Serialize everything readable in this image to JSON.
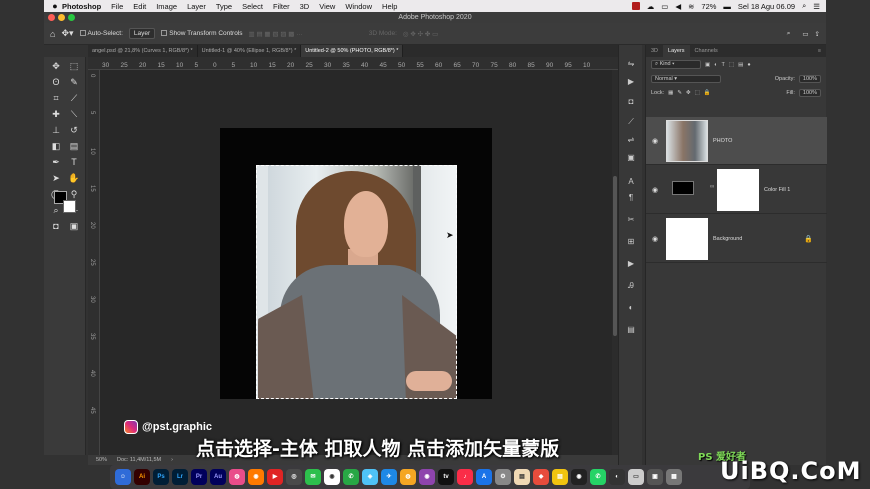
{
  "menubar": {
    "apple": "",
    "items": [
      "Photoshop",
      "File",
      "Edit",
      "Image",
      "Layer",
      "Type",
      "Select",
      "Filter",
      "3D",
      "View",
      "Window",
      "Help"
    ],
    "battery": "72%",
    "datetime": "Sel 18 Agu 06.09"
  },
  "window": {
    "title": "Adobe Photoshop 2020"
  },
  "options": {
    "auto_select": "Auto-Select:",
    "target": "Layer",
    "show_transform": "Show Transform Controls",
    "mode_3d": "3D Mode:"
  },
  "tabs": [
    "angel.psd @ 21,8% (Curves 1, RGB/8*) *",
    "Untitled-1 @ 40% (Ellipse 1, RGB/8*) *",
    "Untitled-2 @ 50% (PHOTO, RGB/8*) *"
  ],
  "ruler": {
    "h": [
      "30",
      "25",
      "20",
      "15",
      "10",
      "5",
      "0",
      "5",
      "10",
      "15",
      "20",
      "25",
      "30",
      "35",
      "40",
      "45",
      "50",
      "55",
      "60",
      "65",
      "70",
      "75",
      "80",
      "85",
      "90",
      "95",
      "10"
    ],
    "v": [
      "0",
      "5",
      "10",
      "15",
      "20",
      "25",
      "30",
      "35",
      "40",
      "45"
    ]
  },
  "status": {
    "zoom": "50%",
    "doc": "Doc: 11,4M/11,5M"
  },
  "panel": {
    "tabs": [
      "3D",
      "Layers",
      "Channels"
    ],
    "kind": "Kind",
    "blend": "Normal",
    "opacity_label": "Opacity:",
    "opacity": "100%",
    "lock_label": "Lock:",
    "fill_label": "Fill:",
    "fill": "100%"
  },
  "layers": [
    {
      "name": "PHOTO"
    },
    {
      "name": "Color Fill 1"
    },
    {
      "name": "Background"
    }
  ],
  "dock": [
    "Ai",
    "Ps",
    "Lr",
    "Pr",
    "Au",
    "tv"
  ],
  "overlay": {
    "handle": "@pst.graphic",
    "subtitle": "点击选择-主体 扣取人物 点击添加矢量蒙版",
    "wm_top": "PS 爱好者",
    "wm": "UiBQ.CoM"
  }
}
